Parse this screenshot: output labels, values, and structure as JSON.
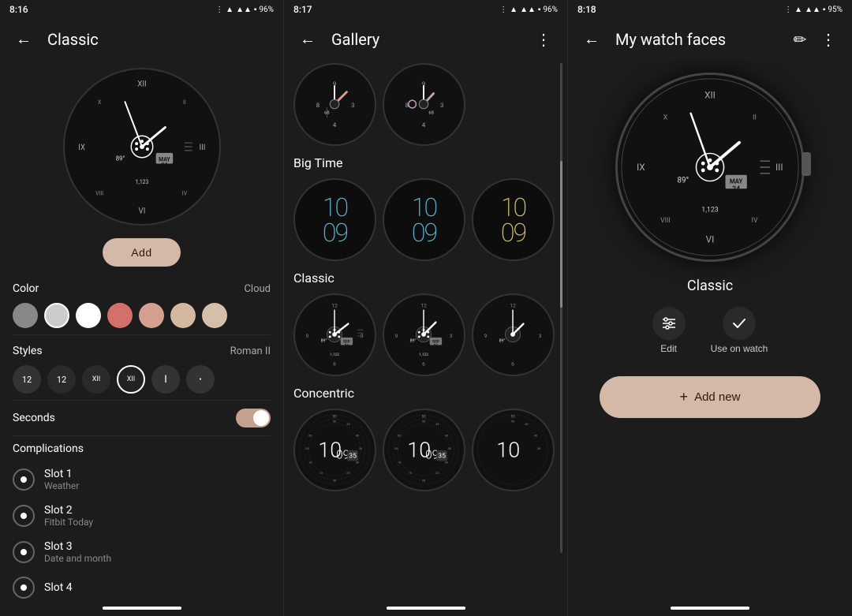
{
  "panels": {
    "left": {
      "status": {
        "time": "8:16",
        "battery": "96%"
      },
      "title": "Classic",
      "add_button": "Add",
      "color_section": {
        "label": "Color",
        "value": "Cloud",
        "swatches": [
          "#888888",
          "#cccccc",
          "#ffffff",
          "#d4706a",
          "#d4a090",
          "#d4b8a0",
          "#d4c0a8"
        ]
      },
      "styles_section": {
        "label": "Styles",
        "value": "Roman II",
        "options": [
          "12",
          "12",
          "XII",
          "XII",
          "I",
          "•"
        ]
      },
      "seconds_section": {
        "label": "Seconds",
        "enabled": true
      },
      "complications": {
        "title": "Complications",
        "slots": [
          {
            "name": "Slot 1",
            "sub": "Weather"
          },
          {
            "name": "Slot 2",
            "sub": "Fitbit Today"
          },
          {
            "name": "Slot 3",
            "sub": "Date and month"
          },
          {
            "name": "Slot 4",
            "sub": ""
          }
        ]
      }
    },
    "middle": {
      "status": {
        "time": "8:17",
        "battery": "96%"
      },
      "title": "Gallery",
      "sections": [
        {
          "name": "Big Time",
          "watches": [
            {
              "style": "bigtime-blue",
              "hour": "10",
              "min": "09"
            },
            {
              "style": "bigtime-blue",
              "hour": "10",
              "min": "09"
            },
            {
              "style": "bigtime-yellow",
              "hour": "10",
              "min": "09"
            }
          ]
        },
        {
          "name": "Classic",
          "watches": [
            {
              "style": "classic"
            },
            {
              "style": "classic"
            },
            {
              "style": "classic-partial"
            }
          ]
        },
        {
          "name": "Concentric",
          "watches": [
            {
              "style": "concentric",
              "hour": "10",
              "min": "09",
              "sec": "35"
            },
            {
              "style": "concentric",
              "hour": "10",
              "min": "09",
              "sec": "35"
            },
            {
              "style": "concentric-partial"
            }
          ]
        }
      ]
    },
    "right": {
      "status": {
        "time": "8:18",
        "battery": "95%"
      },
      "title": "My watch faces",
      "watch_name": "Classic",
      "actions": [
        {
          "label": "Edit",
          "icon": "sliders"
        },
        {
          "label": "Use on watch",
          "icon": "check"
        }
      ],
      "add_new_label": "+ Add new"
    }
  }
}
